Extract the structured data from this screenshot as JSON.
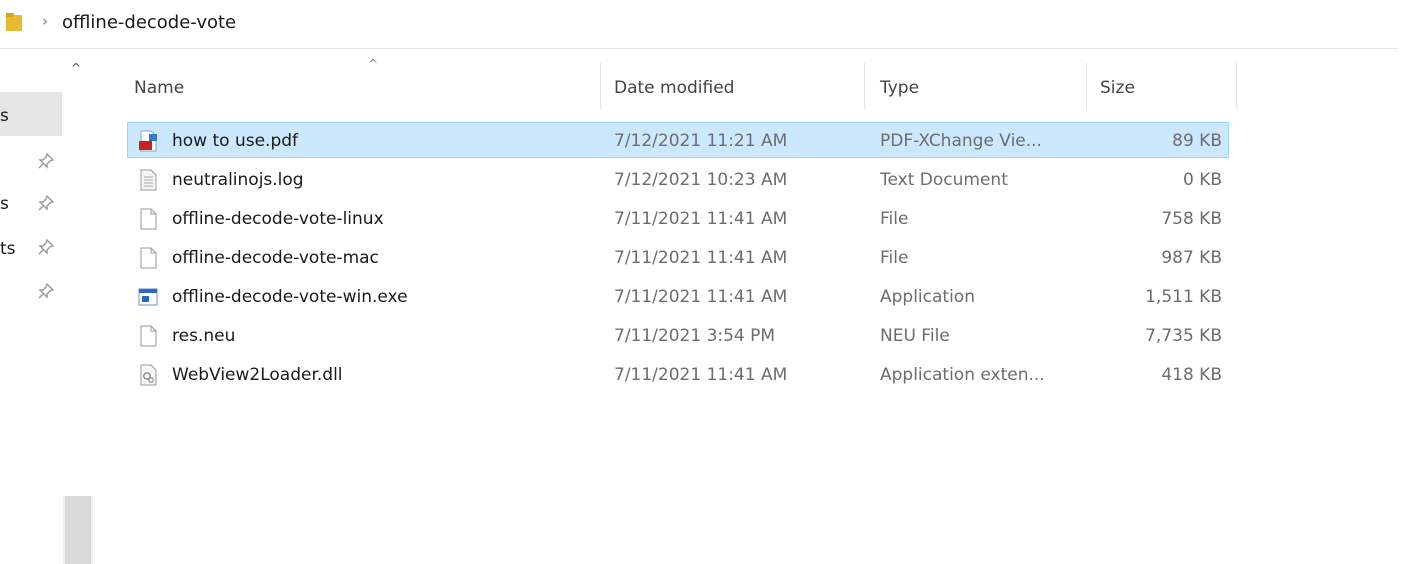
{
  "breadcrumb": {
    "separator": "›",
    "current_folder": "offline-decode-vote"
  },
  "nav_pane": {
    "partial_labels": [
      "s",
      "s",
      "ts"
    ],
    "scroll_up_glyph": "^"
  },
  "file_list": {
    "sort_glyph": "^",
    "columns": {
      "name": "Name",
      "date_modified": "Date modified",
      "type": "Type",
      "size": "Size"
    },
    "rows": [
      {
        "name": "how to use.pdf",
        "date": "7/12/2021 11:21 AM",
        "type": "PDF-XChange Vie...",
        "size": "89 KB",
        "icon": "pdf-file-icon",
        "selected": true
      },
      {
        "name": "neutralinojs.log",
        "date": "7/12/2021 10:23 AM",
        "type": "Text Document",
        "size": "0 KB",
        "icon": "text-file-icon",
        "selected": false
      },
      {
        "name": "offline-decode-vote-linux",
        "date": "7/11/2021 11:41 AM",
        "type": "File",
        "size": "758 KB",
        "icon": "blank-file-icon",
        "selected": false
      },
      {
        "name": "offline-decode-vote-mac",
        "date": "7/11/2021 11:41 AM",
        "type": "File",
        "size": "987 KB",
        "icon": "blank-file-icon",
        "selected": false
      },
      {
        "name": "offline-decode-vote-win.exe",
        "date": "7/11/2021 11:41 AM",
        "type": "Application",
        "size": "1,511 KB",
        "icon": "application-icon",
        "selected": false
      },
      {
        "name": "res.neu",
        "date": "7/11/2021 3:54 PM",
        "type": "NEU File",
        "size": "7,735 KB",
        "icon": "blank-file-icon",
        "selected": false
      },
      {
        "name": "WebView2Loader.dll",
        "date": "7/11/2021 11:41 AM",
        "type": "Application exten...",
        "size": "418 KB",
        "icon": "dll-file-icon",
        "selected": false
      }
    ]
  },
  "colors": {
    "selection_bg": "#cce8ff",
    "selection_border": "#99d1ff",
    "folder_yellow": "#e8b932"
  }
}
